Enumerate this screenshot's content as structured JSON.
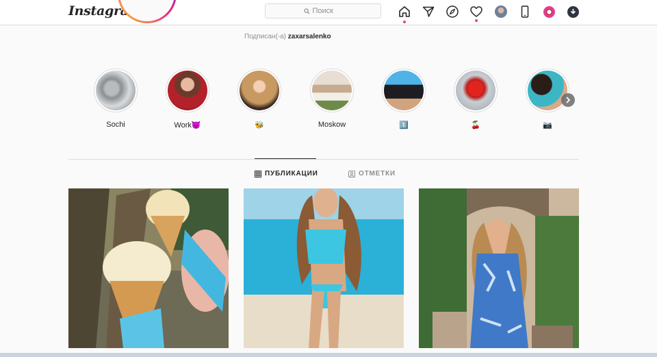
{
  "app": {
    "logo_text": "Instagram",
    "accent_color": "#ed4956"
  },
  "search": {
    "placeholder": "Поиск",
    "icon": "search-icon"
  },
  "nav": {
    "icons": [
      "home-icon",
      "direct-icon",
      "explore-icon",
      "activity-icon",
      "profile-avatar",
      "mobile-icon",
      "extension-icon",
      "download-icon"
    ]
  },
  "profile": {
    "following_prefix": "Подписан(-а)",
    "following_user": "zaxarsalenko"
  },
  "highlights": [
    {
      "label": "Sochi"
    },
    {
      "label": "Work😈"
    },
    {
      "label": "🐝"
    },
    {
      "label": "Moskow"
    },
    {
      "label": "1️⃣"
    },
    {
      "label": "🍒"
    },
    {
      "label": "📷"
    }
  ],
  "tabs": [
    {
      "label": "ПУБЛИКАЦИИ",
      "icon": "grid-icon",
      "active": true
    },
    {
      "label": "ОТМЕТКИ",
      "icon": "tagged-icon",
      "active": false
    }
  ],
  "posts": [
    {
      "subject": "ice-cream-photo"
    },
    {
      "subject": "beach-swimsuit-photo"
    },
    {
      "subject": "floral-dress-photo"
    }
  ]
}
